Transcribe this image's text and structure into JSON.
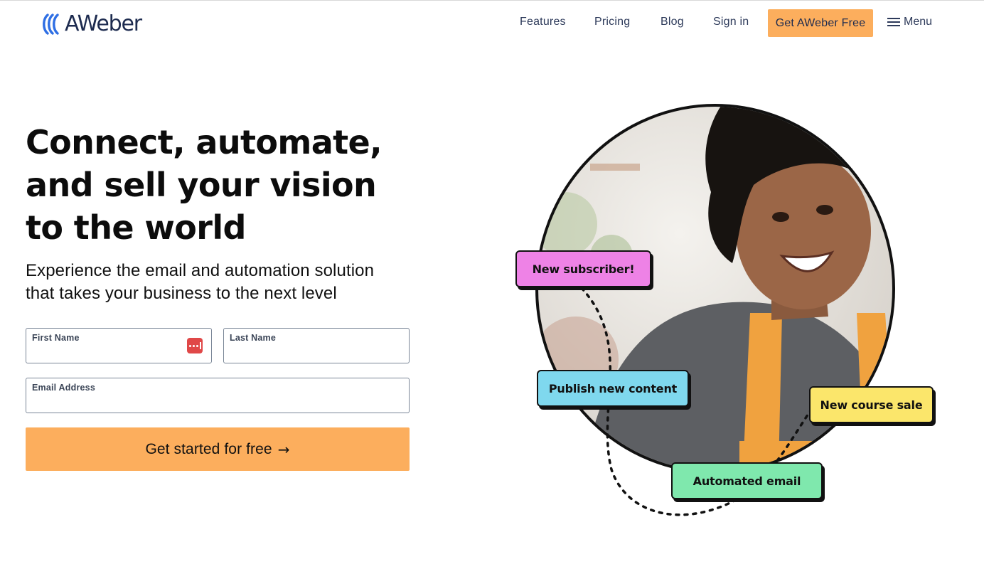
{
  "brand": {
    "logo_text": "AWeber",
    "logo_icon": "aweber-waves-logo-icon"
  },
  "nav": {
    "links": [
      "Features",
      "Pricing",
      "Blog",
      "Sign in"
    ],
    "cta_label": "Get AWeber Free",
    "menu_label": "Menu",
    "menu_icon": "hamburger-icon"
  },
  "hero": {
    "headline": [
      "Connect, automate,",
      "and sell your vision",
      "to the world"
    ],
    "subhead": [
      "Experience the email and automation solution",
      "that takes your business to the next level"
    ]
  },
  "form": {
    "first_name_label": "First Name",
    "last_name_label": "Last Name",
    "email_label": "Email Address",
    "first_name_value": "",
    "last_name_value": "",
    "email_value": "",
    "password_manager_icon": "password-manager-icon",
    "submit_label": "Get started for free",
    "submit_arrow": "→"
  },
  "illustration": {
    "chips": [
      {
        "label": "New subscriber!",
        "color": "#ee82e6"
      },
      {
        "label": "Publish new content",
        "color": "#7fd8ee"
      },
      {
        "label": "New course sale",
        "color": "#fbe66b"
      },
      {
        "label": "Automated email",
        "color": "#7fe8ad"
      }
    ]
  },
  "colors": {
    "accent_orange": "#fcae5d",
    "nav_text": "#2d3a5a",
    "logo_blue": "#2f6fe4",
    "logo_navy": "#1d2b4f"
  }
}
